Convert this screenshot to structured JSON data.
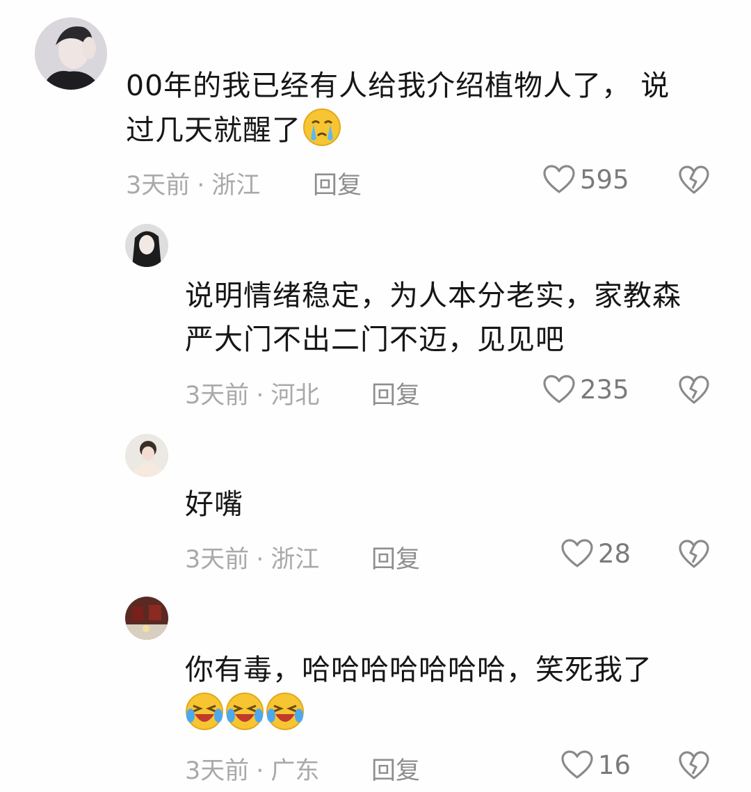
{
  "comments": [
    {
      "text_line1": "00年的我已经有人给我介绍植物人了， 说",
      "text_line2": "过几天就醒了",
      "emojis": [
        "crying-emoji"
      ],
      "time": "3天前",
      "separator": "·",
      "location": "浙江",
      "reply_label": "回复",
      "likes": "595"
    },
    {
      "text_line1": "说明情绪稳定，为人本分老实，家教森",
      "text_line2": "严大门不出二门不迈，见见吧",
      "emojis": [],
      "time": "3天前",
      "separator": "·",
      "location": "河北",
      "reply_label": "回复",
      "likes": "235"
    },
    {
      "text_line1": "好嘴",
      "text_line2": "",
      "emojis": [],
      "time": "3天前",
      "separator": "·",
      "location": "浙江",
      "reply_label": "回复",
      "likes": "28"
    },
    {
      "text_line1": "你有毒，哈哈哈哈哈哈哈，笑死我了",
      "text_line2": "",
      "emojis": [
        "laughing-crying-emoji",
        "laughing-crying-emoji",
        "laughing-crying-emoji"
      ],
      "time": "3天前",
      "separator": "·",
      "location": "广东",
      "reply_label": "回复",
      "likes": "16"
    }
  ],
  "colors": {
    "text": "#161616",
    "meta": "#a9a9a9",
    "icon": "#8a8a8a",
    "emoji_yellow": "#f7c531"
  }
}
